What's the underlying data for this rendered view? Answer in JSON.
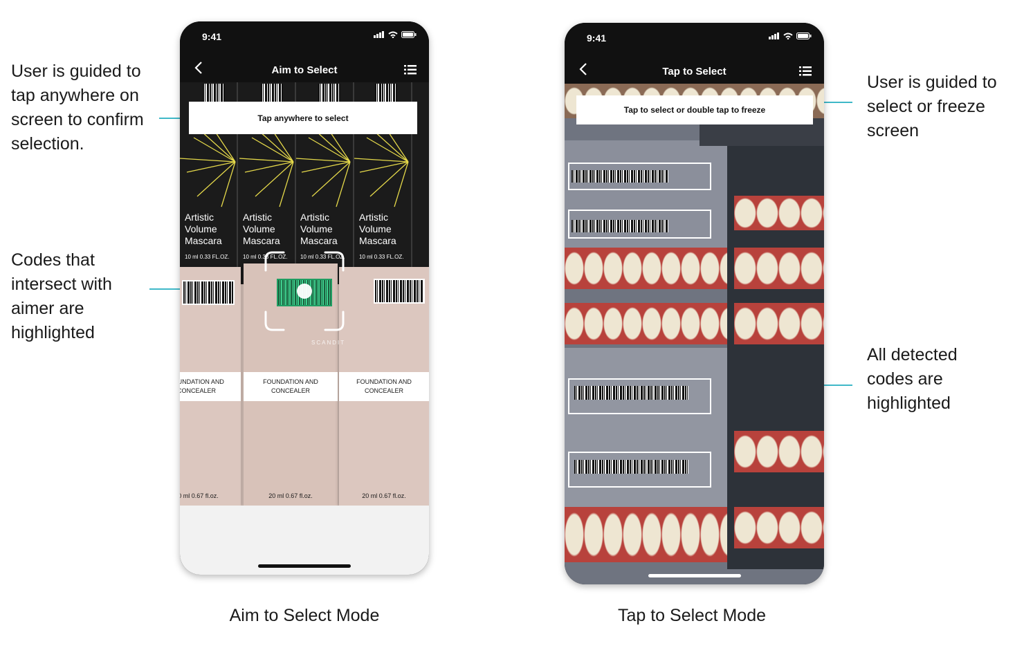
{
  "annotations": {
    "aim_confirm": [
      "User is guided to",
      "tap anywhere on",
      "screen to confirm",
      "selection."
    ],
    "aim_highlight": [
      "Codes that",
      "intersect with",
      "aimer are",
      "highlighted"
    ],
    "tap_guide": [
      "User is guided to",
      "select or freeze",
      "screen"
    ],
    "tap_all": [
      "All detected",
      "codes are",
      "highlighted"
    ]
  },
  "captions": {
    "aim": "Aim to Select Mode",
    "tap": "Tap to Select Mode"
  },
  "phone_aim": {
    "time": "9:41",
    "title": "Aim to Select",
    "banner": "Tap anywhere to select",
    "product_top": {
      "line1": "Artistic",
      "line2": "Volume",
      "line3": "Mascara",
      "size": "10 ml 0.33 FL.OZ."
    },
    "product_bottom": {
      "line1": "FOUNDATION AND",
      "line2": "CONCEALER",
      "size": "20 ml 0.67 fl.oz."
    },
    "watermark": "SCANDIT"
  },
  "phone_tap": {
    "time": "9:41",
    "title": "Tap to Select",
    "banner": "Tap to select or double tap to freeze"
  },
  "colors": {
    "accent_line": "#3fb8c8",
    "highlight_green": "#3ecf8e"
  },
  "icons": [
    "back-chevron-icon",
    "list-icon",
    "signal-icon",
    "wifi-icon",
    "battery-icon"
  ]
}
